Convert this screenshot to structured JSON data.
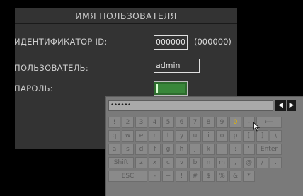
{
  "dialog": {
    "title": "ИМЯ ПОЛЬЗОВАТЕЛЯ",
    "id_label": "ИДЕНТИФИКАТОР ID:",
    "id_value": "000000",
    "id_default": "(000000)",
    "user_label": "ПОЛЬЗОВАТЕЛЬ:",
    "user_value": "admin",
    "password_label": "ПАРОЛЬ:"
  },
  "keyboard": {
    "input_text": "••••••",
    "nav_prev": "◀",
    "nav_next": "▶",
    "rows": [
      [
        "!",
        "2",
        "3",
        "4",
        "5",
        "6",
        "7",
        "8",
        "9",
        "0",
        "-",
        "⟵"
      ],
      [
        "q",
        "w",
        "e",
        "r",
        "t",
        "y",
        "u",
        "i",
        "o",
        "p",
        "[",
        "]",
        "\\"
      ],
      [
        "a",
        "s",
        "d",
        "f",
        "g",
        "h",
        "j",
        "k",
        "l",
        ";",
        "'",
        "Enter"
      ],
      [
        "Shift",
        "z",
        "x",
        "c",
        "v",
        "b",
        "n",
        "m",
        ",",
        "@",
        "/",
        "."
      ],
      [
        "ESC",
        "-",
        "+",
        "!",
        "#",
        "$",
        "%",
        "&",
        "*"
      ]
    ],
    "highlighted_key": "0"
  },
  "colors": {
    "dialog_bg": "#333333",
    "keyboard_bg": "#7a7a7a",
    "password_active": "#39873a",
    "highlight": "#e6b800"
  },
  "icons": {
    "cursor": "mouse-pointer-icon"
  }
}
